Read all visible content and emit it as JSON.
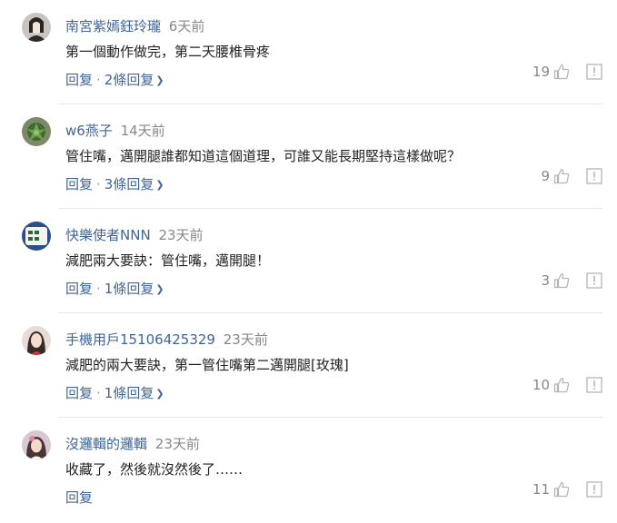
{
  "comments": [
    {
      "user": "南宮紫嫣鈺玲瓏",
      "time": "6天前",
      "text": "第一個動作做完，第二天腰椎骨疼",
      "reply": "回复",
      "replies": "2條回复",
      "likes": "19"
    },
    {
      "user": "w6燕子",
      "time": "14天前",
      "text": "管住嘴，邁開腿誰都知道這個道理，可誰又能長期堅持這樣做呢？",
      "reply": "回复",
      "replies": "3條回复",
      "likes": "9"
    },
    {
      "user": "快樂使者NNN",
      "time": "23天前",
      "text": "減肥兩大要訣：管住嘴，邁開腿！",
      "reply": "回复",
      "replies": "1條回复",
      "likes": "3"
    },
    {
      "user": "手機用戶15106425329",
      "time": "23天前",
      "text": "減肥的兩大要訣，第一管住嘴第二邁開腿[玫瑰]",
      "reply": "回复",
      "replies": "1條回复",
      "likes": "10"
    },
    {
      "user": "沒邏輯的邏輯",
      "time": "23天前",
      "text": "收藏了，然後就沒然後了……",
      "reply": "回复",
      "replies": "",
      "likes": "11"
    }
  ],
  "colors": {
    "username": "#406599",
    "link": "#406599",
    "muted": "#888888"
  },
  "icons": {
    "like": "thumbs-up-icon",
    "report": "report-icon",
    "expand": "chevron-down-icon"
  }
}
